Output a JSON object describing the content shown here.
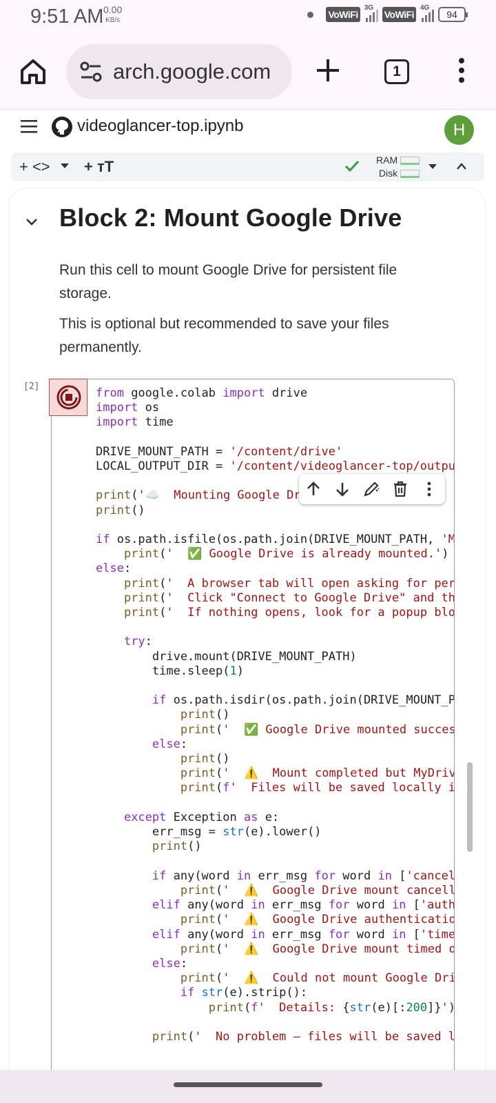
{
  "status_bar": {
    "time": "9:51 AM",
    "speed_value": "0.00",
    "speed_unit": "KB/s",
    "vowifi_1": "VoWiFi",
    "net_1": "3G",
    "vowifi_2": "VoWiFi",
    "net_2": "4G",
    "battery": "94"
  },
  "browser": {
    "url": "arch.google.com",
    "tab_count": "1"
  },
  "colab": {
    "notebook_title": "videoglancer-top.ipynb",
    "avatar_letter": "H",
    "toolbar": {
      "code_icon": "+ <>",
      "text_icon": "+ ᴛT",
      "ram_label": "RAM",
      "disk_label": "Disk"
    },
    "section_title": "Block 2: Mount Google Drive",
    "paragraphs": [
      "Run this cell to mount Google Drive for persistent file storage.",
      "This is optional but recommended to save your files permanently."
    ],
    "cell_execution_label": "[2]"
  }
}
